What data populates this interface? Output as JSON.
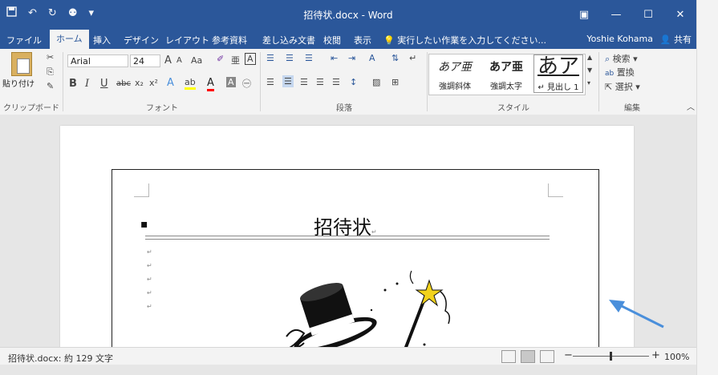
{
  "titlebar": {
    "save_icon": "save-icon",
    "undo": "↶",
    "redo": "↻",
    "touch": "⚉",
    "dropdown": "▾",
    "title": "招待状.docx - Word",
    "ribbon_opts": "▣",
    "minimize": "—",
    "maximize": "☐",
    "close": "✕"
  },
  "tabs": [
    {
      "label": "ファイル"
    },
    {
      "label": "ホーム"
    },
    {
      "label": "挿入"
    },
    {
      "label": "デザイン"
    },
    {
      "label": "レイアウト"
    },
    {
      "label": "参考資料"
    },
    {
      "label": "差し込み文書"
    },
    {
      "label": "校閲"
    },
    {
      "label": "表示"
    },
    {
      "label": "実行したい作業を入力してください..."
    }
  ],
  "user": "Yoshie Kohama",
  "share": "共有",
  "ribbon": {
    "clipboard": {
      "paste": "貼り付け",
      "label": "クリップボード"
    },
    "font": {
      "name": "Arial",
      "size": "24",
      "label": "フォント",
      "grow": "A",
      "shrink": "A",
      "case": "Aa",
      "bold": "B",
      "italic": "I",
      "underline": "U",
      "strike": "abc",
      "sub": "x₂",
      "sup": "x²"
    },
    "paragraph": {
      "label": "段落"
    },
    "styles": {
      "label": "スタイル",
      "items": [
        {
          "preview": "あア亜",
          "name": "強調斜体"
        },
        {
          "preview": "あア亜",
          "name": "強調太字"
        },
        {
          "preview": "あア",
          "name": "↵ 見出し 1"
        }
      ]
    },
    "editing": {
      "label": "編集",
      "find": "検索",
      "replace": "置換",
      "select": "選択"
    }
  },
  "document": {
    "title": "招待状",
    "return_mark": "↵",
    "bullet": "▪"
  },
  "status": {
    "doc_info": "招待状.docx: 約 129 文字",
    "zoom": "100%"
  },
  "colors": {
    "word_blue": "#2b579a",
    "arrow": "#4a8fdb"
  }
}
